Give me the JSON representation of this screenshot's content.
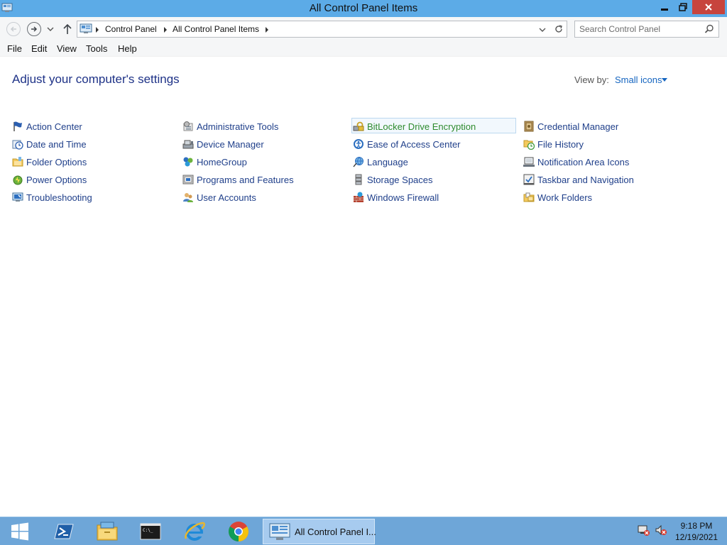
{
  "window": {
    "title": "All Control Panel Items"
  },
  "address": {
    "breadcrumbs": [
      "Control Panel",
      "All Control Panel Items"
    ]
  },
  "search": {
    "placeholder": "Search Control Panel"
  },
  "menu": [
    "File",
    "Edit",
    "View",
    "Tools",
    "Help"
  ],
  "main": {
    "heading": "Adjust your computer's settings",
    "view_by_label": "View by:",
    "view_by_value": "Small icons"
  },
  "items": [
    {
      "label": "Action Center",
      "icon": "flag-icon"
    },
    {
      "label": "Administrative Tools",
      "icon": "admin-tools-icon"
    },
    {
      "label": "BitLocker Drive Encryption",
      "icon": "bitlocker-icon"
    },
    {
      "label": "Credential Manager",
      "icon": "credential-vault-icon"
    },
    {
      "label": "Date and Time",
      "icon": "clock-icon"
    },
    {
      "label": "Device Manager",
      "icon": "device-manager-icon"
    },
    {
      "label": "Ease of Access Center",
      "icon": "ease-of-access-icon"
    },
    {
      "label": "File History",
      "icon": "file-history-icon"
    },
    {
      "label": "Folder Options",
      "icon": "folder-options-icon"
    },
    {
      "label": "HomeGroup",
      "icon": "homegroup-icon"
    },
    {
      "label": "Language",
      "icon": "language-icon"
    },
    {
      "label": "Notification Area Icons",
      "icon": "notification-area-icon"
    },
    {
      "label": "Power Options",
      "icon": "power-options-icon"
    },
    {
      "label": "Programs and Features",
      "icon": "programs-icon"
    },
    {
      "label": "Storage Spaces",
      "icon": "storage-spaces-icon"
    },
    {
      "label": "Taskbar and Navigation",
      "icon": "taskbar-icon"
    },
    {
      "label": "Troubleshooting",
      "icon": "troubleshooting-icon"
    },
    {
      "label": "User Accounts",
      "icon": "user-accounts-icon"
    },
    {
      "label": "Windows Firewall",
      "icon": "firewall-icon"
    },
    {
      "label": "Work Folders",
      "icon": "work-folders-icon"
    }
  ],
  "taskbar": {
    "active_window": "All Control Panel I...",
    "apps": [
      "start-icon",
      "powershell-icon",
      "file-explorer-icon",
      "command-prompt-icon",
      "internet-explorer-icon",
      "chrome-icon"
    ]
  },
  "tray": {
    "time": "9:18 PM",
    "date": "12/19/2021"
  },
  "colors": {
    "titlebar": "#5cabe7",
    "link": "#1f3f8a",
    "heading": "#1e3287",
    "close_button": "#c7443d",
    "taskbar": "#6ea6d8"
  }
}
